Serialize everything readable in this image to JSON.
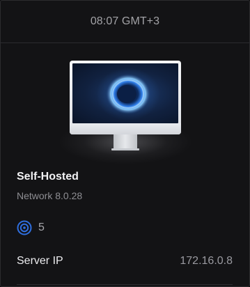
{
  "header": {
    "time": "08:07 GMT+3"
  },
  "device": {
    "name": "Self-Hosted",
    "version": "Network 8.0.28",
    "image_icon": "monitor-icon"
  },
  "clients": {
    "icon": "wifi-clients-icon",
    "count": "5",
    "accent_color": "#2f6fe0"
  },
  "details": {
    "server_ip_label": "Server IP",
    "server_ip_value": "172.16.0.8"
  }
}
